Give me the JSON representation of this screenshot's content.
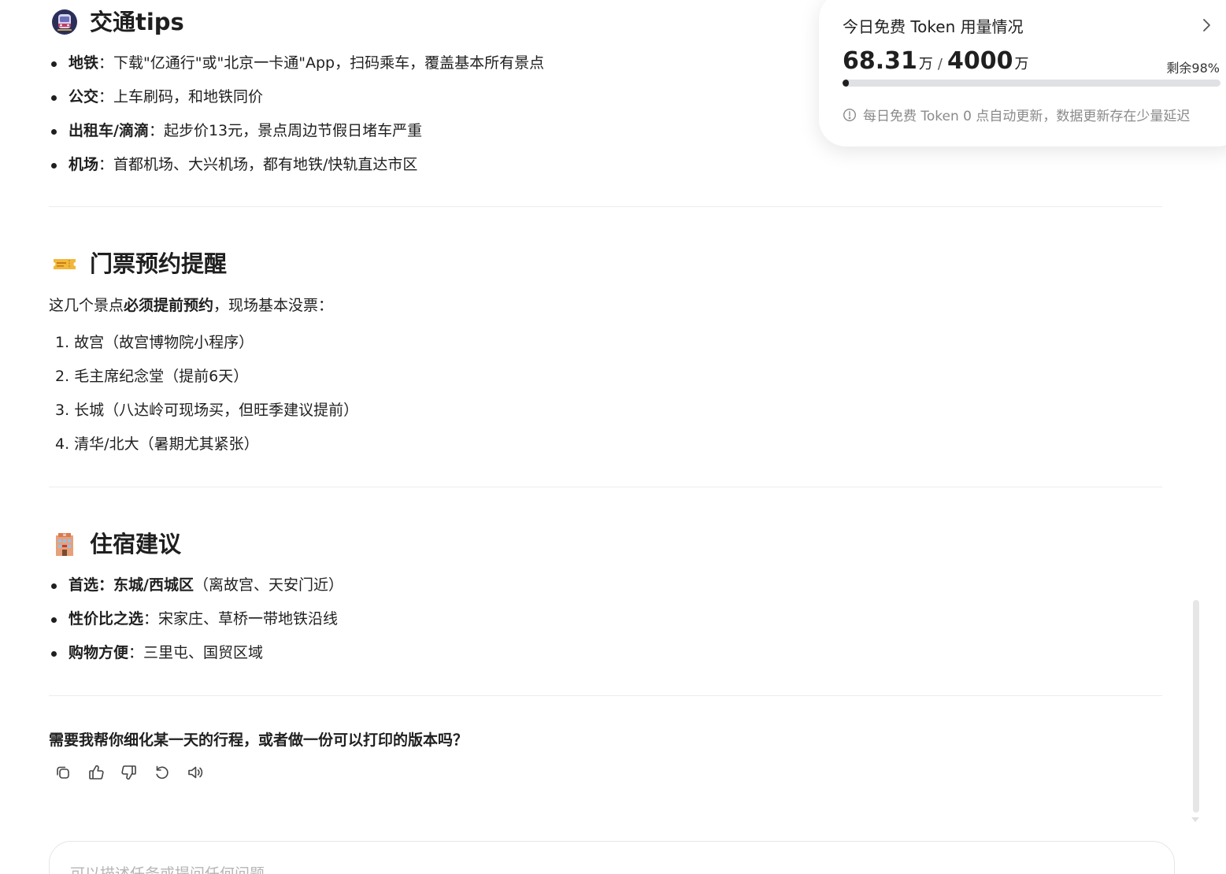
{
  "sections": {
    "transport": {
      "heading": "交通tips",
      "items": [
        {
          "label": "地铁",
          "text": "：下载\"亿通行\"或\"北京一卡通\"App，扫码乘车，覆盖基本所有景点"
        },
        {
          "label": "公交",
          "text": "：上车刷码，和地铁同价"
        },
        {
          "label": "出租车/滴滴",
          "text": "：起步价13元，景点周边节假日堵车严重"
        },
        {
          "label": "机场",
          "text": "：首都机场、大兴机场，都有地铁/快轨直达市区"
        }
      ]
    },
    "tickets": {
      "heading": "门票预约提醒",
      "intro_pre": "这几个景点",
      "intro_bold": "必须提前预约",
      "intro_post": "，现场基本没票：",
      "items": [
        "1. 故宫（故宫博物院小程序）",
        "2. 毛主席纪念堂（提前6天）",
        "3. 长城（八达岭可现场买，但旺季建议提前）",
        "4. 清华/北大（暑期尤其紧张）"
      ]
    },
    "lodging": {
      "heading": "住宿建议",
      "items": [
        {
          "label": "首选：东城/西城区",
          "text": "（离故宫、天安门近）"
        },
        {
          "label": "性价比之选",
          "text": "：宋家庄、草桥一带地铁沿线"
        },
        {
          "label": "购物方便",
          "text": "：三里屯、国贸区域"
        }
      ]
    }
  },
  "followup_question": "需要我帮你细化某一天的行程，或者做一份可以打印的版本吗？",
  "actions": [
    {
      "name": "copy-icon"
    },
    {
      "name": "thumbs-up-icon"
    },
    {
      "name": "thumbs-down-icon"
    },
    {
      "name": "regenerate-icon"
    },
    {
      "name": "speaker-icon"
    }
  ],
  "token_card": {
    "title": "今日免费 Token 用量情况",
    "used": "68.31",
    "used_unit": "万",
    "slash": "/",
    "total": "4000",
    "total_unit": "万",
    "remaining": "剩余98%",
    "used_fraction": 0.017,
    "note": "每日免费 Token 0 点自动更新，数据更新存在少量延迟"
  },
  "input": {
    "placeholder": "可以描述任务或提问任何问题"
  },
  "colors": {
    "text": "#1f1f1f",
    "muted": "#8a8a8a",
    "divider": "#ececec",
    "bar_track": "#dfe1e4"
  }
}
